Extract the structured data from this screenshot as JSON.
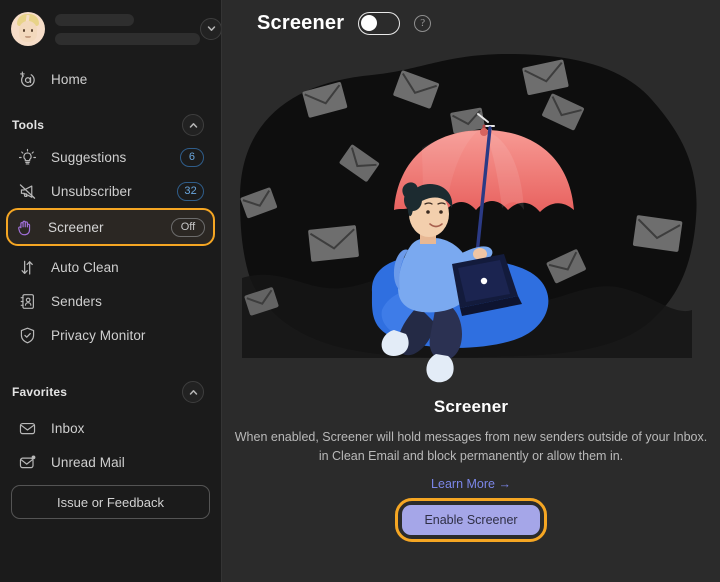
{
  "sidebar": {
    "account": {
      "avatar_name": "user-avatar",
      "name_redacted": "",
      "email_redacted": "",
      "dropdown_icon": "chevron-down-icon"
    },
    "home": {
      "label": "Home",
      "icon": "at-sparkle-icon"
    },
    "tools": {
      "title": "Tools",
      "collapse_icon": "chevron-up-icon",
      "items": [
        {
          "label": "Suggestions",
          "icon": "lightbulb-icon",
          "badge": "6",
          "badge_type": "count"
        },
        {
          "label": "Unsubscriber",
          "icon": "megaphone-off-icon",
          "badge": "32",
          "badge_type": "count"
        },
        {
          "label": "Screener",
          "icon": "hand-stop-icon",
          "badge": "Off",
          "badge_type": "state",
          "highlighted": true
        },
        {
          "label": "Auto Clean",
          "icon": "auto-clean-arrows-icon",
          "badge": "",
          "badge_type": "none"
        },
        {
          "label": "Senders",
          "icon": "address-book-icon",
          "badge": "",
          "badge_type": "none"
        },
        {
          "label": "Privacy Monitor",
          "icon": "shield-check-icon",
          "badge": "",
          "badge_type": "none"
        }
      ]
    },
    "favorites": {
      "title": "Favorites",
      "collapse_icon": "chevron-up-icon",
      "items": [
        {
          "label": "Inbox",
          "icon": "envelope-icon"
        },
        {
          "label": "Unread Mail",
          "icon": "envelope-dot-icon"
        }
      ]
    },
    "feedback_button": "Issue or Feedback"
  },
  "main": {
    "header": {
      "title": "Screener",
      "toggle_state": "off",
      "help_icon": "question-mark-icon"
    },
    "illustration": {
      "name": "person-with-umbrella-blocking-mail-illustration",
      "umbrella_color": "#f07575",
      "beanbag_color": "#2f6fe0",
      "shirt_color": "#7aa9f0",
      "envelope_color": "#6e6e6e"
    },
    "card": {
      "title": "Screener",
      "description_line1": "When enabled, Screener will hold messages from new senders outside of your Inbox.",
      "description_line2": "in Clean Email and block permanently or allow them in.",
      "learn_more": "Learn More →",
      "cta_label": "Enable Screener"
    }
  },
  "colors": {
    "sidebar_bg": "#1b1b1b",
    "main_bg": "#2b2b2b",
    "annotation_orange": "#f5a623",
    "badge_blue": "#6aa6dd",
    "link_blue": "#7b86e8",
    "cta_bg": "#a5a6e8",
    "screener_icon_purple": "#a06fd8"
  }
}
